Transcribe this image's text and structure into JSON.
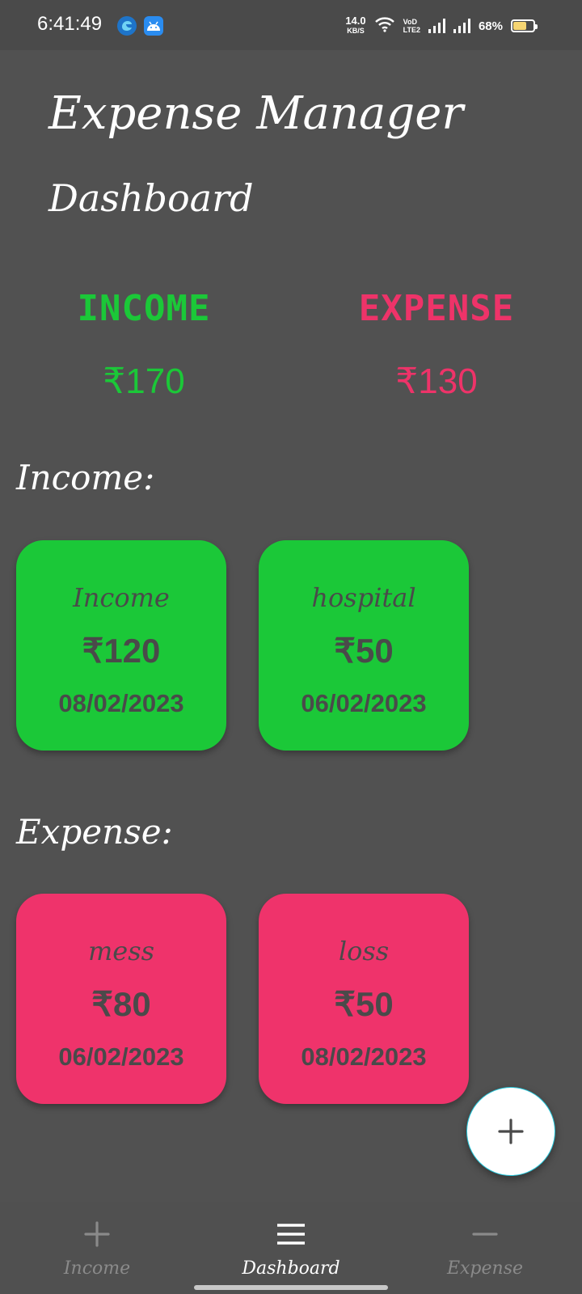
{
  "status_bar": {
    "time": "6:41:49",
    "net_speed": "14.0",
    "net_unit": "KB/S",
    "volte_top": "VoD",
    "volte_bottom": "LTE2",
    "battery_percent": "68%",
    "battery_level": 0.68,
    "notification_icons": [
      "edge-browser-icon",
      "android-icon"
    ]
  },
  "header": {
    "app_title": "Expense Manager",
    "page_title": "Dashboard"
  },
  "summary": {
    "income_label": "INCOME",
    "income_total": "₹170",
    "expense_label": "EXPENSE",
    "expense_total": "₹130"
  },
  "income_section": {
    "heading": "Income:",
    "items": [
      {
        "name": "Income",
        "amount": "₹120",
        "date": "08/02/2023"
      },
      {
        "name": "hospital",
        "amount": "₹50",
        "date": "06/02/2023"
      }
    ]
  },
  "expense_section": {
    "heading": "Expense:",
    "items": [
      {
        "name": "mess",
        "amount": "₹80",
        "date": "06/02/2023"
      },
      {
        "name": "loss",
        "amount": "₹50",
        "date": "08/02/2023"
      }
    ]
  },
  "fab": {
    "icon": "plus-icon"
  },
  "bottom_nav": {
    "items": [
      {
        "label": "Income",
        "icon": "plus-icon",
        "active": false
      },
      {
        "label": "Dashboard",
        "icon": "menu-icon",
        "active": true
      },
      {
        "label": "Expense",
        "icon": "minus-icon",
        "active": false
      }
    ]
  },
  "colors": {
    "background": "#515151",
    "income_green": "#1bc838",
    "expense_pink": "#ef336b",
    "card_text": "#4a4a4a",
    "fab_background": "#ffffff"
  }
}
